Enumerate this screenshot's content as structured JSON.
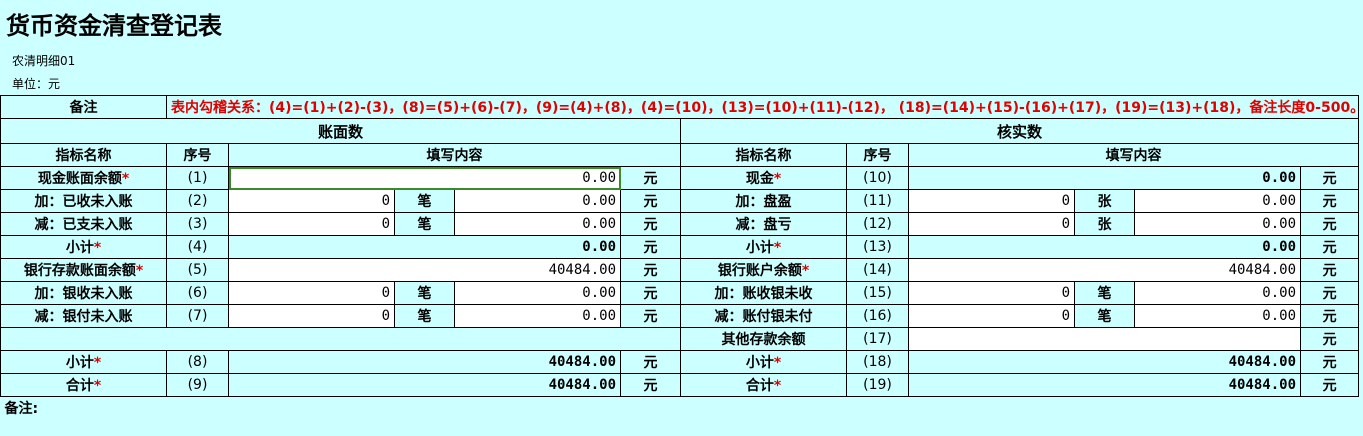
{
  "title": "货币资金清查登记表",
  "org": "农清明细01",
  "unit": "单位：元",
  "remark_label": "备注",
  "formula": "表内勾稽关系：(4)=(1)+(2)-(3)，(8)=(5)+(6)-(7)，(9)=(4)+(8)，(4)=(10)，(13)=(10)+(11)-(12)， (18)=(14)+(15)-(16)+(17)，(19)=(13)+(18)，备注长度0-500。",
  "left_section": "账面数",
  "right_section": "核实数",
  "col_headers": {
    "name": "指标名称",
    "seq": "序号",
    "content": "填写内容"
  },
  "unit_yuan": "元",
  "unit_bi": "笔",
  "unit_zhang": "张",
  "star": "*",
  "rows": [
    {
      "left": {
        "name": "现金账面余额",
        "star": true,
        "seq": "(1)",
        "type": "single",
        "value": "0.00",
        "editable": true,
        "selected": true
      },
      "right": {
        "name": "现金",
        "star": true,
        "seq": "(10)",
        "type": "single",
        "value": "0.00",
        "editable": false
      }
    },
    {
      "left": {
        "name": "加：已收未入账",
        "star": false,
        "seq": "(2)",
        "type": "count",
        "count": "0",
        "count_unit": "笔",
        "value": "0.00"
      },
      "right": {
        "name": "加：盘盈",
        "star": false,
        "seq": "(11)",
        "type": "count",
        "count": "0",
        "count_unit": "张",
        "value": "0.00"
      }
    },
    {
      "left": {
        "name": "减：已支未入账",
        "star": false,
        "seq": "(3)",
        "type": "count",
        "count": "0",
        "count_unit": "笔",
        "value": "0.00"
      },
      "right": {
        "name": "减：盘亏",
        "star": false,
        "seq": "(12)",
        "type": "count",
        "count": "0",
        "count_unit": "张",
        "value": "0.00"
      }
    },
    {
      "left": {
        "name": "小计",
        "star": true,
        "seq": "(4)",
        "type": "single",
        "value": "0.00",
        "editable": false
      },
      "right": {
        "name": "小计",
        "star": true,
        "seq": "(13)",
        "type": "single",
        "value": "0.00",
        "editable": false
      }
    },
    {
      "left": {
        "name": "银行存款账面余额",
        "star": true,
        "seq": "(5)",
        "type": "single",
        "value": "40484.00",
        "editable": true
      },
      "right": {
        "name": "银行账户余额",
        "star": true,
        "seq": "(14)",
        "type": "single",
        "value": "40484.00",
        "editable": true
      }
    },
    {
      "left": {
        "name": "加：银收未入账",
        "star": false,
        "seq": "(6)",
        "type": "count",
        "count": "0",
        "count_unit": "笔",
        "value": "0.00"
      },
      "right": {
        "name": "加：账收银未收",
        "star": false,
        "seq": "(15)",
        "type": "count",
        "count": "0",
        "count_unit": "笔",
        "value": "0.00"
      }
    },
    {
      "left": {
        "name": "减：银付未入账",
        "star": false,
        "seq": "(7)",
        "type": "count",
        "count": "0",
        "count_unit": "笔",
        "value": "0.00"
      },
      "right": {
        "name": "减：账付银未付",
        "star": false,
        "seq": "(16)",
        "type": "count",
        "count": "0",
        "count_unit": "笔",
        "value": "0.00"
      }
    },
    {
      "left": {
        "type": "blank"
      },
      "right": {
        "name": "其他存款余额",
        "star": false,
        "seq": "(17)",
        "type": "single",
        "value": "",
        "editable": true
      }
    },
    {
      "left": {
        "name": "小计",
        "star": true,
        "seq": "(8)",
        "type": "single",
        "value": "40484.00",
        "editable": false
      },
      "right": {
        "name": "小计",
        "star": true,
        "seq": "(18)",
        "type": "single",
        "value": "40484.00",
        "editable": false
      }
    },
    {
      "left": {
        "name": "合计",
        "star": true,
        "seq": "(9)",
        "type": "single",
        "value": "40484.00",
        "editable": false
      },
      "right": {
        "name": "合计",
        "star": true,
        "seq": "(19)",
        "type": "single",
        "value": "40484.00",
        "editable": false
      }
    }
  ],
  "bottom_note": "备注:"
}
